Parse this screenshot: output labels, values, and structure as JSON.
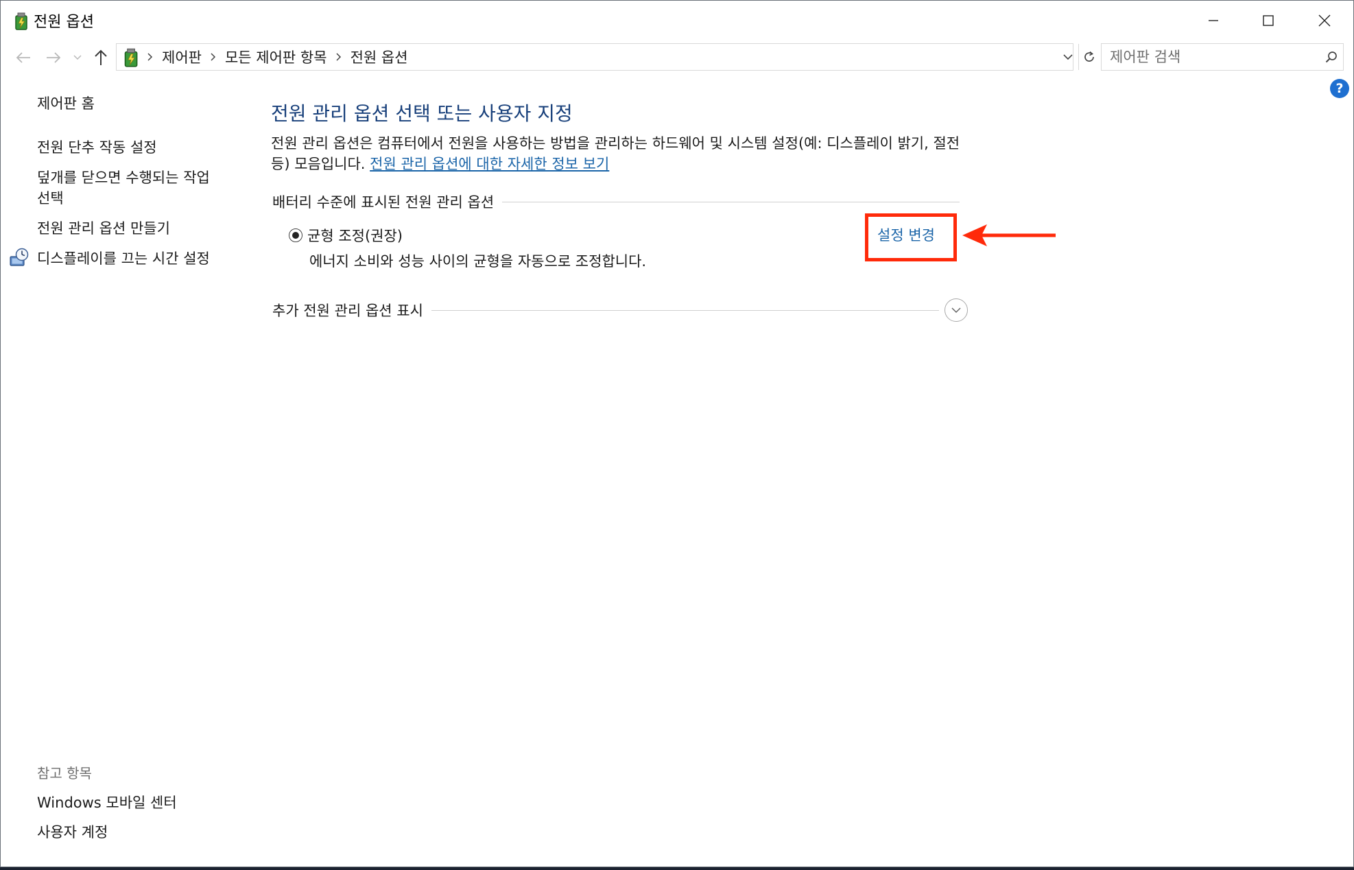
{
  "window": {
    "title": "전원 옵션",
    "icon": "power-options-icon"
  },
  "address": {
    "crumbs": [
      "제어판",
      "모든 제어판 항목",
      "전원 옵션"
    ],
    "search_placeholder": "제어판 검색"
  },
  "sidebar": {
    "home": "제어판 홈",
    "links": [
      "전원 단추 작동 설정",
      "덮개를 닫으면 수행되는 작업\n선택",
      "전원 관리 옵션 만들기",
      "디스플레이를 끄는 시간 설정"
    ],
    "see_also_label": "참고 항목",
    "see_also": [
      "Windows 모바일 센터",
      "사용자 계정"
    ]
  },
  "main": {
    "title": "전원 관리 옵션 선택 또는 사용자 지정",
    "description": "전원 관리 옵션은 컴퓨터에서 전원을 사용하는 방법을 관리하는 하드웨어 및 시스템 설정(예: 디스플레이 밝기, 절전 등) 모음입니다. ",
    "description_link": "전원 관리 옵션에 대한 자세한 정보 보기",
    "battery_group": "배터리 수준에 표시된 전원 관리 옵션",
    "plan": {
      "name": "균형 조정(권장)",
      "description": "에너지 소비와 성능 사이의 균형을 자동으로 조정합니다.",
      "selected": true,
      "change_link": "설정 변경"
    },
    "extra_group": "추가 전원 관리 옵션 표시"
  },
  "help": {
    "label": "?"
  },
  "colors": {
    "title_blue": "#173f7a",
    "link_blue": "#1a64a8",
    "annotation_red": "#ff2a0a"
  }
}
